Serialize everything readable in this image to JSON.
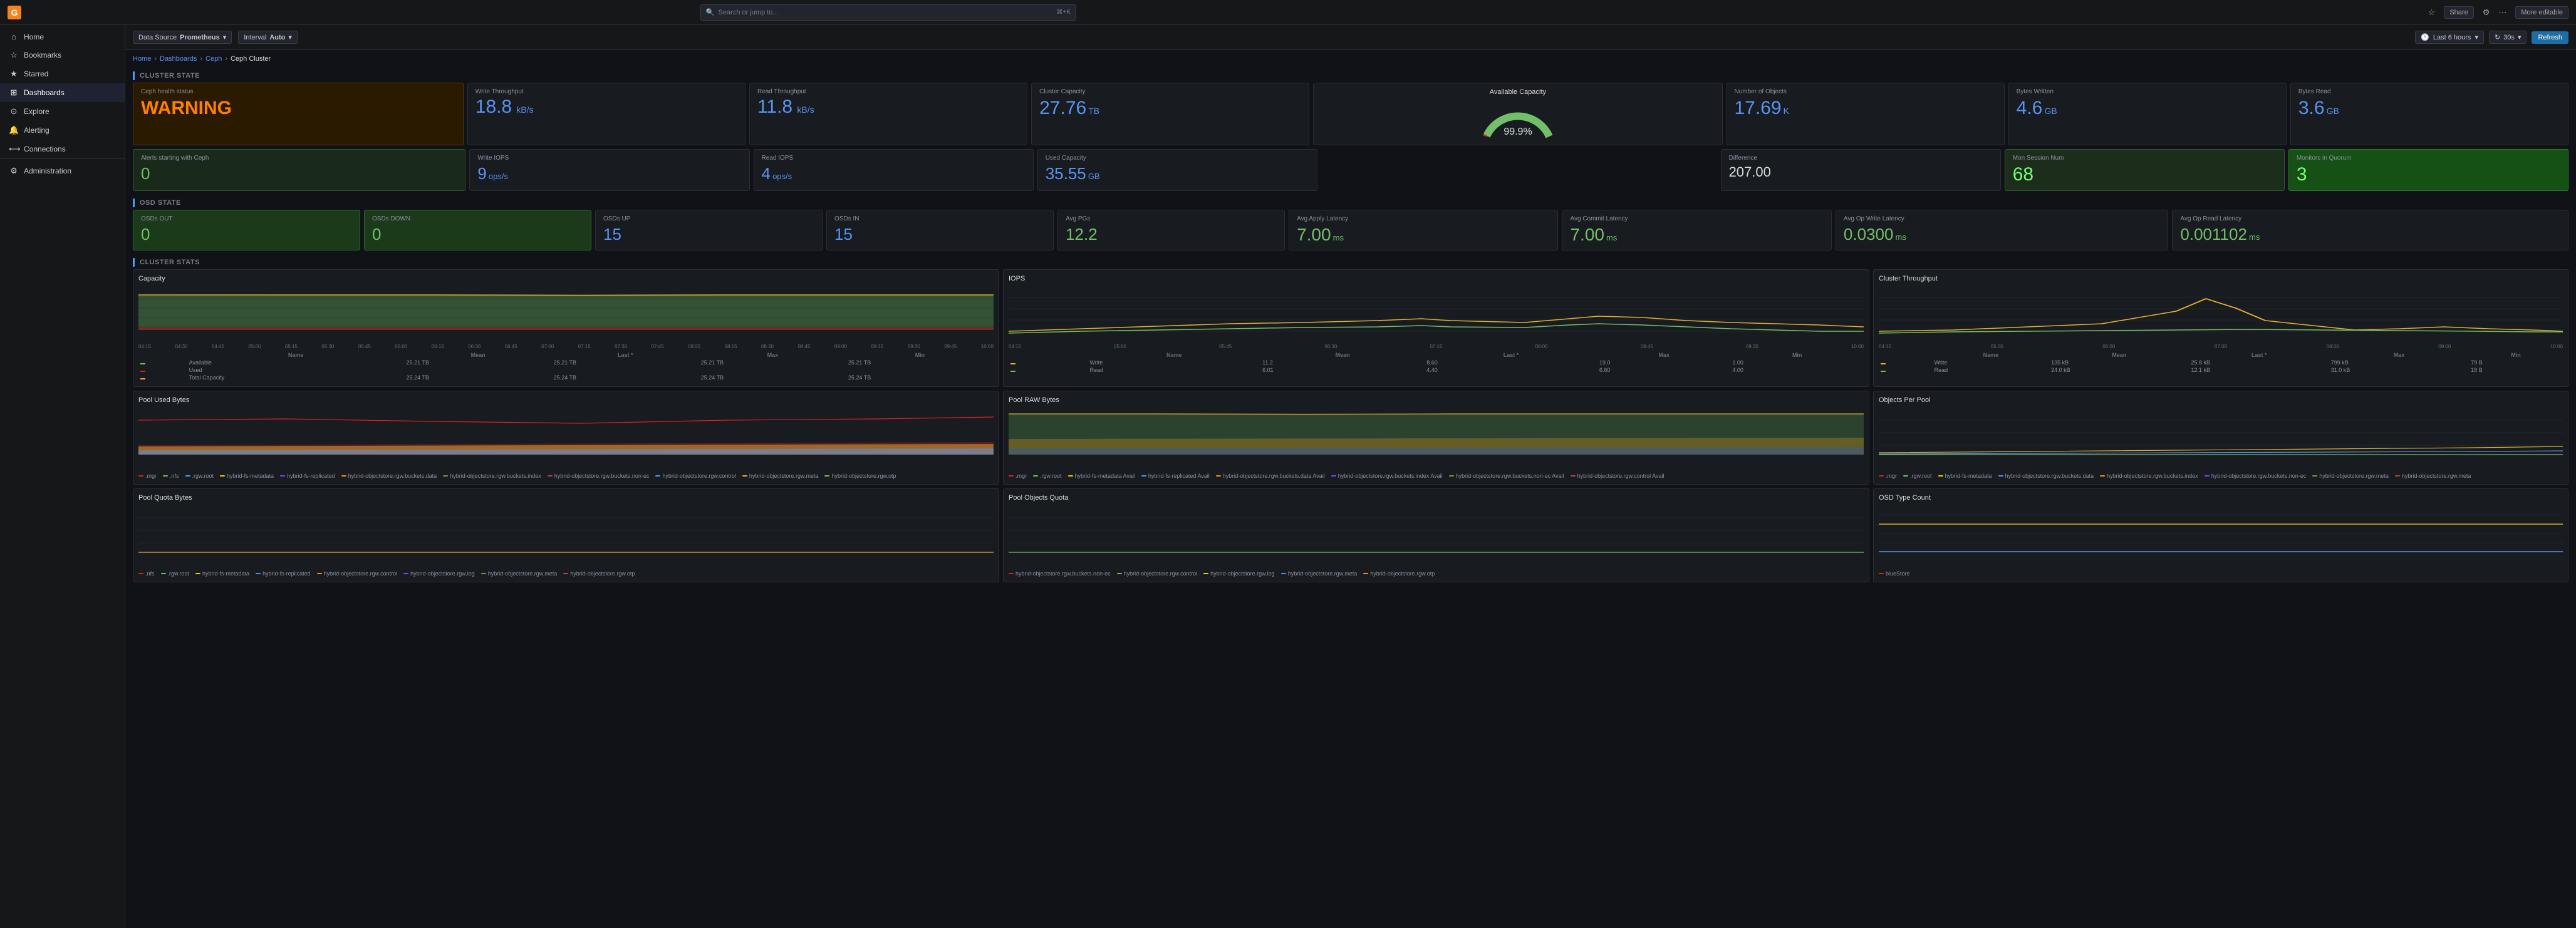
{
  "app": {
    "title": "Grafana",
    "logo": "G"
  },
  "topbar": {
    "search_placeholder": "Search or jump to...",
    "shortcut": "⌘+K",
    "share_label": "Share",
    "more_label": "More editable"
  },
  "breadcrumb": {
    "items": [
      "Home",
      "Dashboards",
      "Ceph",
      "Ceph Cluster"
    ]
  },
  "toolbar": {
    "data_source_label": "Data Source",
    "data_source_value": "Prometheus",
    "interval_label": "Interval",
    "interval_value": "Auto",
    "time_range": "Last 6 hours",
    "refresh_label": "Refresh",
    "refresh_interval": "30s"
  },
  "sidebar": {
    "items": [
      {
        "id": "home",
        "label": "Home",
        "icon": "⌂"
      },
      {
        "id": "bookmarks",
        "label": "Bookmarks",
        "icon": "☆"
      },
      {
        "id": "starred",
        "label": "Starred",
        "icon": "★"
      },
      {
        "id": "dashboards",
        "label": "Dashboards",
        "icon": "⊞",
        "active": true
      },
      {
        "id": "explore",
        "label": "Explore",
        "icon": "⊙"
      },
      {
        "id": "alerting",
        "label": "Alerting",
        "icon": "🔔"
      },
      {
        "id": "connections",
        "label": "Connections",
        "icon": "⟷"
      },
      {
        "id": "administration",
        "label": "Administration",
        "icon": "⚙"
      }
    ]
  },
  "cluster_state": {
    "title": "CLUSTER STATE",
    "health_label": "Ceph health status",
    "health_value": "WARNING",
    "alerts_label": "Alerts starting with Ceph",
    "alerts_value": "0",
    "write_throughput_label": "Write Throughput",
    "write_throughput_value": "18.8",
    "write_throughput_unit": "kB/s",
    "read_throughput_label": "Read Throughput",
    "read_throughput_value": "11.8",
    "read_throughput_unit": "kB/s",
    "cluster_capacity_label": "Cluster Capacity",
    "cluster_capacity_value": "27.76",
    "cluster_capacity_unit": "TB",
    "available_capacity_label": "Available Capacity",
    "gauge_pct": "99.9%",
    "number_objects_label": "Number of Objects",
    "number_objects_value": "17.69",
    "number_objects_unit": "K",
    "bytes_written_label": "Bytes Written",
    "bytes_written_value": "4.6",
    "bytes_written_unit": "GB",
    "bytes_read_label": "Bytes Read",
    "bytes_read_value": "3.6",
    "bytes_read_unit": "GB",
    "write_iops_label": "Write IOPS",
    "write_iops_value": "9",
    "write_iops_unit": "ops/s",
    "read_iops_label": "Read IOPS",
    "read_iops_value": "4",
    "read_iops_unit": "ops/s",
    "used_capacity_label": "Used Capacity",
    "used_capacity_value": "35.55",
    "used_capacity_unit": "GB",
    "difference_label": "Difference",
    "difference_value": "207.00",
    "mon_session_label": "Mon Session Num",
    "mon_session_value": "68",
    "monitors_quorum_label": "Monitors in Quorum",
    "monitors_quorum_value": "3"
  },
  "osd_state": {
    "title": "OSD STATE",
    "osds_out_label": "OSDs OUT",
    "osds_out_value": "0",
    "osds_down_label": "OSDs DOWN",
    "osds_down_value": "0",
    "osds_up_label": "OSDs UP",
    "osds_up_value": "15",
    "osds_in_label": "OSDs IN",
    "osds_in_value": "15",
    "avg_pgs_label": "Avg PGs",
    "avg_pgs_value": "12.2",
    "avg_apply_latency_label": "Avg Apply Latency",
    "avg_apply_latency_value": "7.00",
    "avg_apply_latency_unit": "ms",
    "avg_commit_latency_label": "Avg Commit Latency",
    "avg_commit_latency_value": "7.00",
    "avg_commit_latency_unit": "ms",
    "avg_op_write_latency_label": "Avg Op Write Latency",
    "avg_op_write_latency_value": "0.0300",
    "avg_op_write_latency_unit": "ms",
    "avg_op_read_latency_label": "Avg Op Read Latency",
    "avg_op_read_latency_value": "0.001102",
    "avg_op_read_latency_unit": "ms"
  },
  "cluster_stats": {
    "title": "CLUSTER STATS",
    "capacity_chart_title": "Capacity",
    "iops_chart_title": "IOPS",
    "cluster_throughput_chart_title": "Cluster Throughput",
    "pool_used_bytes_title": "Pool Used Bytes",
    "pool_raw_bytes_title": "Pool RAW Bytes",
    "objects_per_pool_title": "Objects Per Pool",
    "pool_quota_bytes_title": "Pool Quota Bytes",
    "pool_objects_quota_title": "Pool Objects Quota",
    "osd_type_count_title": "OSD Type Count"
  }
}
